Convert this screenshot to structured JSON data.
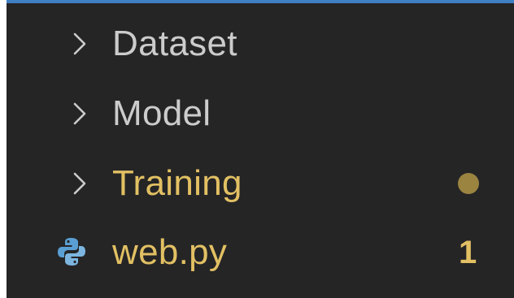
{
  "explorer": {
    "items": [
      {
        "kind": "folder",
        "label": "Dataset",
        "icon": "chevron-right-icon",
        "status": ""
      },
      {
        "kind": "folder",
        "label": "Model",
        "icon": "chevron-right-icon",
        "status": ""
      },
      {
        "kind": "folder",
        "label": "Training",
        "icon": "chevron-right-icon",
        "status": "modified-dot"
      },
      {
        "kind": "file",
        "label": "web.py",
        "icon": "python-file-icon",
        "badge": "1"
      }
    ]
  },
  "colors": {
    "background": "#252526",
    "default_text": "#cccccc",
    "modified_text": "#e2c063",
    "modified_dot": "#9a8440",
    "focus_border": "#3f7fc4",
    "python_blue": "#5a9fd4"
  }
}
